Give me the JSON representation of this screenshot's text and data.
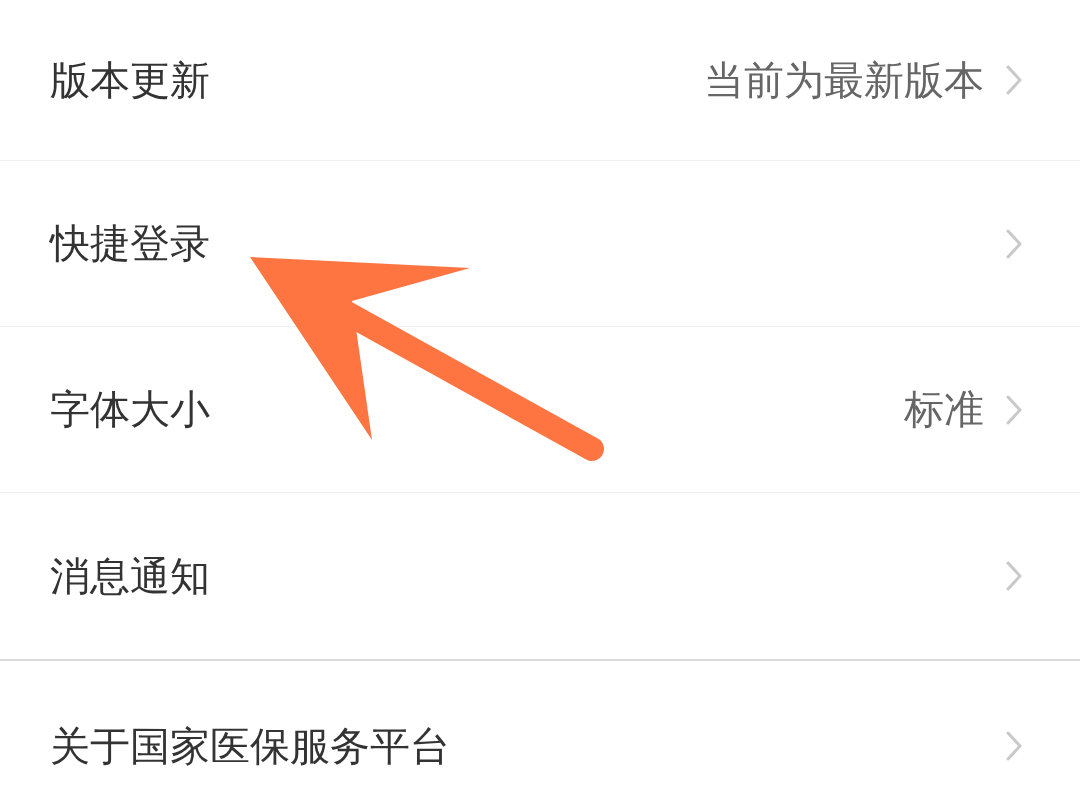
{
  "sections": [
    {
      "items": [
        {
          "label": "版本更新",
          "value": "当前为最新版本"
        },
        {
          "label": "快捷登录"
        },
        {
          "label": "字体大小",
          "value": "标准"
        },
        {
          "label": "消息通知"
        }
      ]
    },
    {
      "items": [
        {
          "label": "关于国家医保服务平台"
        }
      ]
    }
  ],
  "annotation": {
    "kind": "arrow"
  }
}
